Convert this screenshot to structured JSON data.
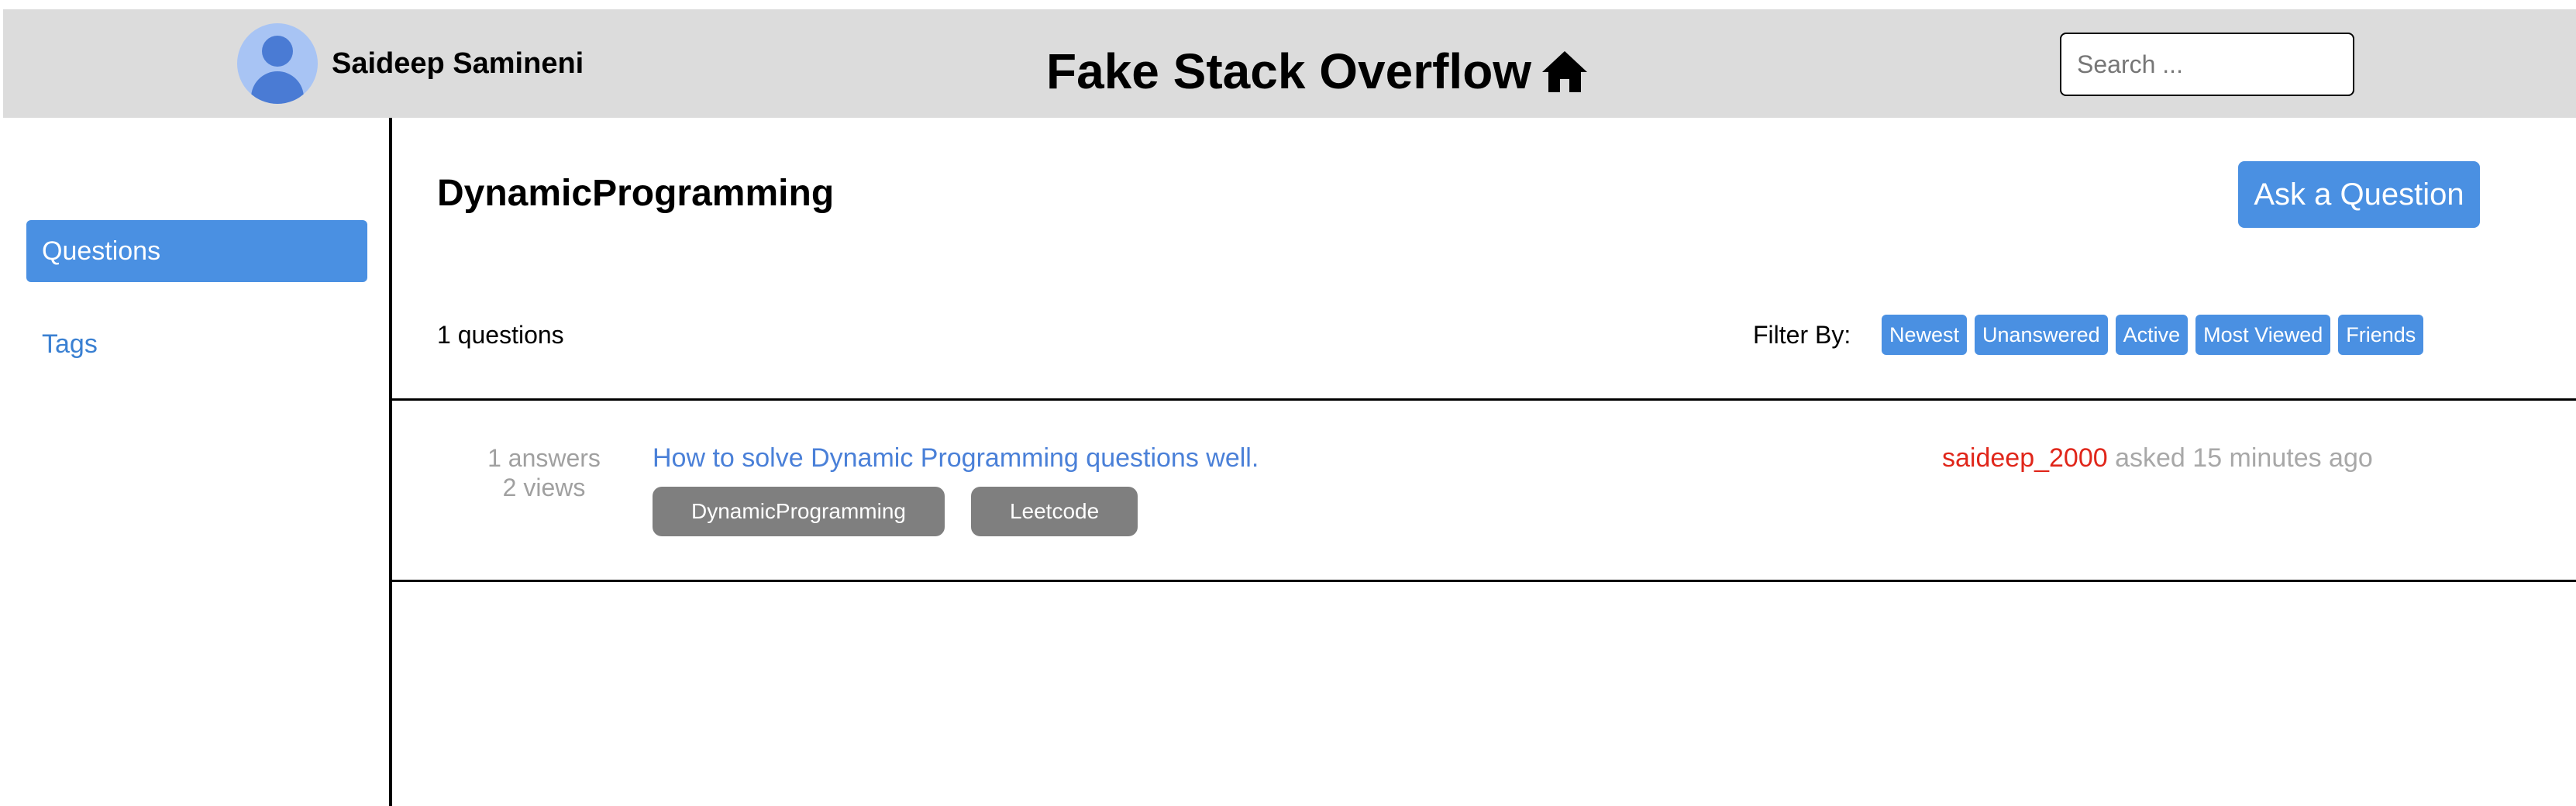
{
  "header": {
    "username": "Saideep Samineni",
    "title": "Fake Stack Overflow",
    "search_placeholder": "Search ...",
    "icons": {
      "avatar": "avatar-icon",
      "home": "home-icon"
    }
  },
  "sidebar": {
    "items": [
      {
        "label": "Questions",
        "active": true
      },
      {
        "label": "Tags",
        "active": false
      }
    ]
  },
  "main": {
    "page_title": "DynamicProgramming",
    "ask_button": "Ask a Question",
    "question_count": "1 questions",
    "filter_label": "Filter By:",
    "filters": [
      "Newest",
      "Unanswered",
      "Active",
      "Most Viewed",
      "Friends"
    ],
    "questions": [
      {
        "answers": "1 answers",
        "views": "2 views",
        "title": "How to solve Dynamic Programming questions well.",
        "tags": [
          "DynamicProgramming",
          "Leetcode"
        ],
        "author": "saideep_2000",
        "asked": "asked 15 minutes ago"
      }
    ]
  },
  "colors": {
    "accent": "#4a90e2",
    "header_bg": "#dcdcdc",
    "tag_bg": "#7f7f7f",
    "author": "#e0261a",
    "muted": "#a0a0a0",
    "link": "#4a80d8"
  }
}
